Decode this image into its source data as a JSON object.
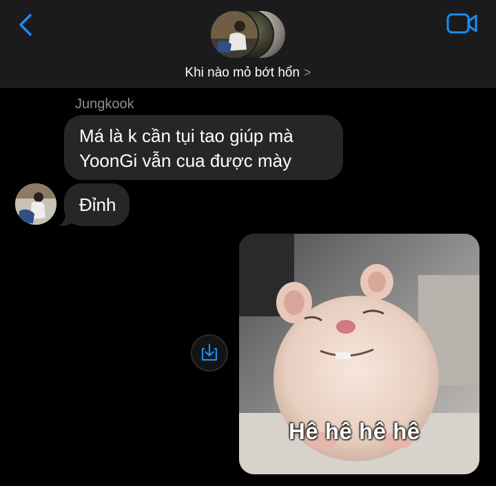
{
  "header": {
    "back_icon": "chevron-left-icon",
    "video_icon": "video-camera-icon",
    "group_name": "Khi nào mỏ bớt hổn",
    "group_chevron": ">",
    "accent": "#1a8cff",
    "background": "#1b1b1d"
  },
  "messages": {
    "sender_name": "Jungkook",
    "bubble_color": "#262628",
    "items": [
      {
        "text": "Má là k cần tụi tao giúp mà YoonGi vẫn cua được mày"
      },
      {
        "text": "Đỉnh"
      }
    ]
  },
  "attachment": {
    "caption": "Hê hê hê hê",
    "save_icon": "save-to-photos-icon"
  }
}
